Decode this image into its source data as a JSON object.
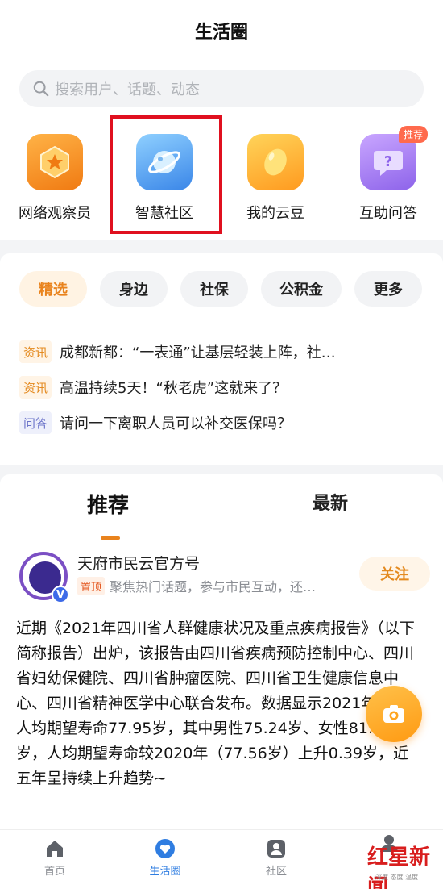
{
  "header": {
    "title": "生活圈"
  },
  "search": {
    "placeholder": "搜索用户、话题、动态"
  },
  "apps": [
    {
      "label": "网络观察员",
      "icon": "badge-star-icon",
      "color": "#f58a1f"
    },
    {
      "label": "智慧社区",
      "icon": "planet-icon",
      "color": "#3a86e8"
    },
    {
      "label": "我的云豆",
      "icon": "bean-icon",
      "color": "#ffa51f"
    },
    {
      "label": "互助问答",
      "icon": "question-bubble-icon",
      "color": "#8d63ea",
      "badge": "推荐"
    }
  ],
  "chips": [
    "精选",
    "身边",
    "社保",
    "公积金",
    "更多"
  ],
  "news": [
    {
      "tag": "资讯",
      "text": "成都新都：“一表通”让基层轻装上阵，社…"
    },
    {
      "tag": "资讯",
      "text": "高温持续5天！“秋老虎”这就来了？"
    },
    {
      "tag": "问答",
      "text": "请问一下离职人员可以补交医保吗？"
    }
  ],
  "tabs": {
    "recommend": "推荐",
    "latest": "最新"
  },
  "post": {
    "author": "天府市民云官方号",
    "pin_tag": "置顶",
    "pin_text": "聚焦热门话题，参与市民互动，还…",
    "follow": "关注",
    "verified": "V",
    "body": "近期《2021年四川省人群健康状况及重点疾病报告》（以下简称报告）出炉，该报告由四川省疾病预防控制中心、四川省妇幼保健院、四川省肿瘤医院、四川省卫生健康信息中心、四川省精神医学中心联合发布。数据显示2021年全省人均期望寿命77.95岁，其中男性75.24岁、女性81.12岁，人均期望寿命较2020年（77.56岁）上升0.39岁，近五年呈持续上升趋势~"
  },
  "tabbar": [
    {
      "label": "首页",
      "icon": "home-icon"
    },
    {
      "label": "生活圈",
      "icon": "heart-circle-icon"
    },
    {
      "label": "社区",
      "icon": "community-icon"
    }
  ],
  "watermark": {
    "title": "红星新闻",
    "sub": "深度 态度 温度"
  },
  "colors": {
    "accent": "#e9831d",
    "blue": "#2f7de1",
    "highlight": "#e0101f"
  }
}
